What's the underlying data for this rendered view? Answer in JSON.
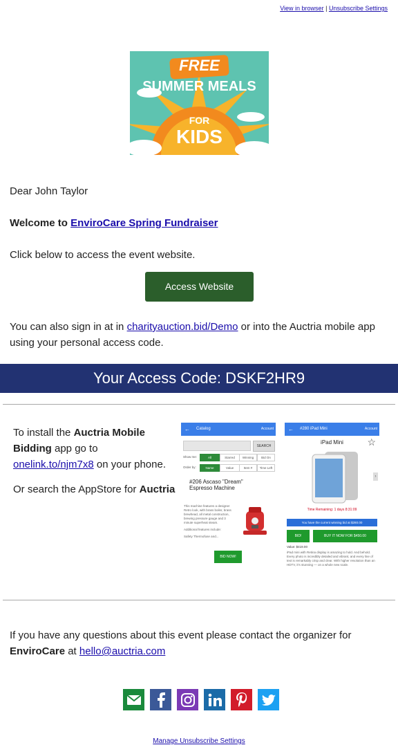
{
  "top_links": {
    "view_in_browser": "View in browser",
    "separator": "|",
    "unsubscribe_settings": "Unsubscribe Settings"
  },
  "banner": {
    "line1": "FREE",
    "line2": "SUMMER MEALS",
    "line3": "FOR",
    "line4": "KIDS"
  },
  "greeting": "Dear John Taylor",
  "welcome": {
    "prefix": "Welcome to",
    "event_link": "EnviroCare Spring Fundraiser"
  },
  "click_below": "Click below to access the event website.",
  "access_button": "Access Website",
  "signin": {
    "prefix": "You can also sign in at in",
    "link": "charityauction.bid/Demo",
    "suffix": "or into the Auctria mobile app using your personal access code."
  },
  "access_code": {
    "label": "Your Access Code:",
    "code": "DSKF2HR9"
  },
  "install": {
    "p1_a": "To install the",
    "p1_bold": "Auctria Mobile Bidding",
    "p1_b": "app go to",
    "p1_link": "onelink.to/njm7x8",
    "p1_c": "on your phone.",
    "p2_a": "Or search the AppStore for",
    "p2_bold": "Auctria"
  },
  "phone1": {
    "title": "Catalog",
    "account": "Account",
    "search_btn": "SEARCH",
    "show_me": "Show me:",
    "show_chips": [
      "All",
      "Starred",
      "Winning",
      "Bid On"
    ],
    "order_by": "Order by:",
    "order_chips": [
      "Name",
      "Value",
      "Item #",
      "Time Left"
    ],
    "item_title": "#206 Ascaso \"Dream\" Espresso Machine",
    "item_desc": "This machine features a designer Retro look, with brass boiler, brass brewhead, all metal construction, brewing pressure gauge and 3 minute superheat steam.",
    "item_desc2": "Additional features include:",
    "item_desc3": "Safety Thermofuse and...",
    "bid_now": "BID NOW!"
  },
  "phone2": {
    "title": "#280 iPad Mini",
    "account": "Account",
    "item_name": "iPad Mini",
    "time_remaining": "Time Remaining: 1 days 8:31:09",
    "current_bid": "You have the current winning bid at $280.00",
    "bid": "BID!",
    "buy_now": "BUY IT NOW FOR $450.00",
    "value": "Value: $419.00",
    "desc": "iPad mini with Retina display is amazing to hold. And behold. Every photo is incredibly detailed and vibrant, and every line of text is remarkably crisp and clear. With higher resolution than an HDTV, it's stunning — on a whole new scale."
  },
  "contact": {
    "text": "If you have any questions about this event please contact the organizer for",
    "org": "EnviroCare",
    "at": "at",
    "email": "hello@auctria.com"
  },
  "social": [
    {
      "icon": "email-icon",
      "color": "#1a8a3c"
    },
    {
      "icon": "facebook-icon",
      "color": "#3b5998"
    },
    {
      "icon": "instagram-icon",
      "color": "#7b3ab5"
    },
    {
      "icon": "linkedin-icon",
      "color": "#1b6ba8"
    },
    {
      "icon": "pinterest-icon",
      "color": "#d21c2a"
    },
    {
      "icon": "twitter-icon",
      "color": "#1da1f2"
    }
  ],
  "footer_link": "Manage Unsubscribe Settings",
  "colors": {
    "access_button": "#2b5e2b",
    "code_band": "#223272",
    "link": "#1a0dab",
    "banner_bg": "#5ec3b0"
  }
}
